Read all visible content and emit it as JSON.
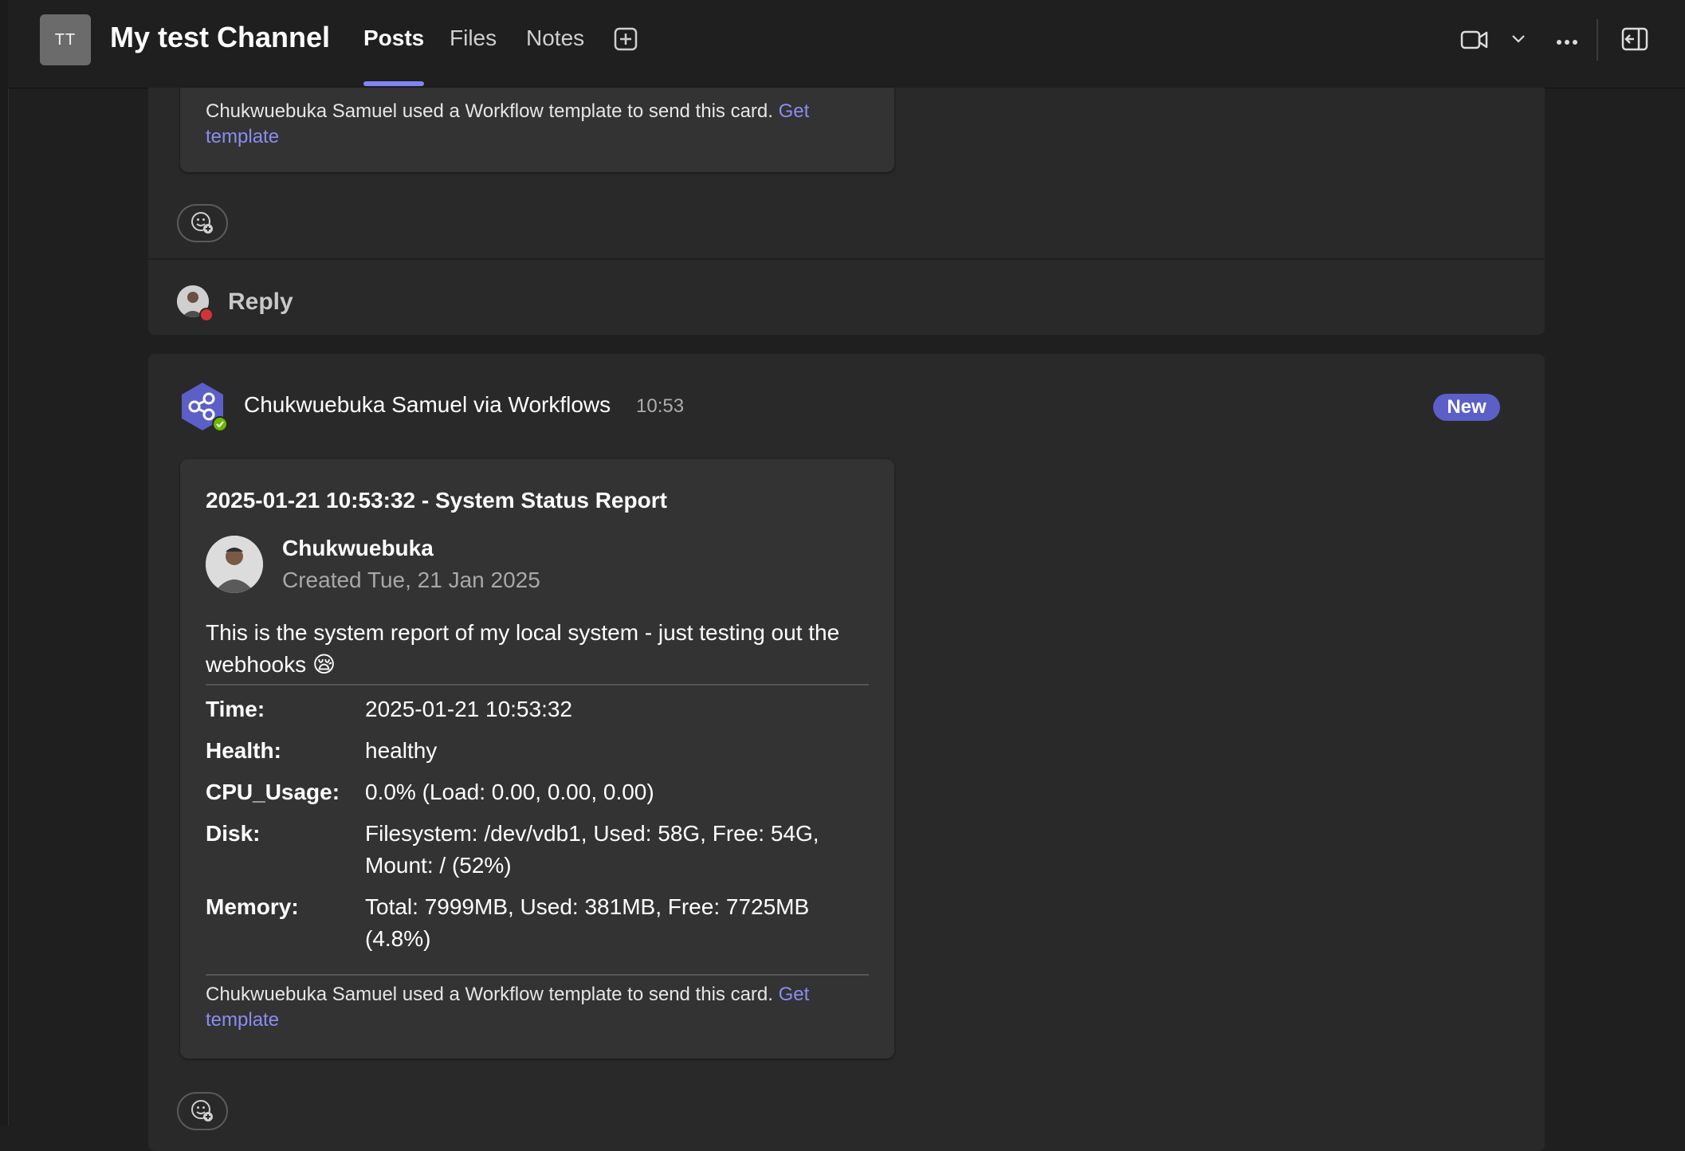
{
  "header": {
    "team_initials": "TT",
    "channel_name": "My test Channel",
    "tabs": [
      {
        "label": "Posts",
        "active": true
      },
      {
        "label": "Files",
        "active": false
      },
      {
        "label": "Notes",
        "active": false
      }
    ],
    "icons": [
      "add-tab-icon",
      "video-camera-icon",
      "chevron-down-icon",
      "more-options-icon",
      "open-panel-icon"
    ]
  },
  "thread1": {
    "card_footer": {
      "text": "Chukwuebuka Samuel used a Workflow template to send this card. ",
      "link": "Get template"
    },
    "reply_label": "Reply"
  },
  "thread2": {
    "sender": "Chukwuebuka Samuel via Workflows",
    "time": "10:53",
    "badge": "New",
    "card": {
      "title": "2025-01-21 10:53:32 - System Status Report",
      "author_name": "Chukwuebuka",
      "author_created": "Created Tue, 21 Jan 2025",
      "description": "This is the system report of my local system - just testing out the webhooks 😪",
      "facts": [
        {
          "key": "Time:",
          "value": "2025-01-21 10:53:32"
        },
        {
          "key": "Health:",
          "value": "healthy"
        },
        {
          "key": "CPU_Usage:",
          "value": "0.0% (Load: 0.00, 0.00, 0.00)"
        },
        {
          "key": "Disk:",
          "value": "Filesystem: /dev/vdb1, Used: 58G, Free: 54G, Mount: / (52%)"
        },
        {
          "key": "Memory:",
          "value": "Total: 7999MB, Used: 381MB, Free: 7725MB (4.8%)"
        }
      ],
      "footer_text": "Chukwuebuka Samuel used a Workflow template to send this card. ",
      "footer_link": "Get template"
    }
  },
  "colors": {
    "accent": "#7f85f5",
    "badge": "#5b5fc7",
    "link": "#8b8cf2",
    "presence_busy": "#d13438",
    "bot_hex": "#5b5fc7",
    "verified": "#6bb700"
  }
}
